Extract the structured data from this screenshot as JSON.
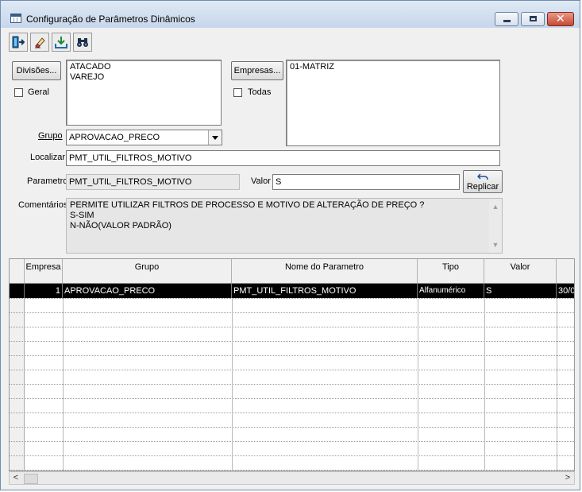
{
  "window": {
    "title": "Configuração de Parâmetros Dinâmicos"
  },
  "toolbar": {
    "icons": [
      "exit-icon",
      "eraser-icon",
      "save-icon",
      "binoculars-icon"
    ]
  },
  "divisoes": {
    "button_label": "Divisões...",
    "geral_label": "Geral",
    "items": [
      "ATACADO",
      "VAREJO"
    ]
  },
  "empresas": {
    "button_label": "Empresas...",
    "todas_label": "Todas",
    "items": [
      "01-MATRIZ"
    ]
  },
  "grupo": {
    "label": "Grupo",
    "value": "APROVACAO_PRECO"
  },
  "localizar": {
    "label": "Localizar",
    "value": "PMT_UTIL_FILTROS_MOTIVO"
  },
  "parametro": {
    "label": "Parametro",
    "value": "PMT_UTIL_FILTROS_MOTIVO"
  },
  "valor": {
    "label": "Valor",
    "value": "S"
  },
  "replicar": {
    "label": "Replicar"
  },
  "comentarios": {
    "label": "Comentários",
    "lines": [
      "PERMITE UTILIZAR FILTROS DE PROCESSO E MOTIVO DE ALTERAÇÃO DE PREÇO ?",
      "S-SIM",
      "N-NÃO(VALOR PADRÃO)"
    ]
  },
  "grid": {
    "columns": [
      "Empresa",
      "Grupo",
      "Nome do Parametro",
      "Tipo",
      "Valor"
    ],
    "rows": [
      {
        "empresa": "1",
        "grupo": "APROVACAO_PRECO",
        "nome": "PMT_UTIL_FILTROS_MOTIVO",
        "tipo": "Alfanumérico",
        "valor": "S",
        "extra": "30/0"
      }
    ]
  }
}
